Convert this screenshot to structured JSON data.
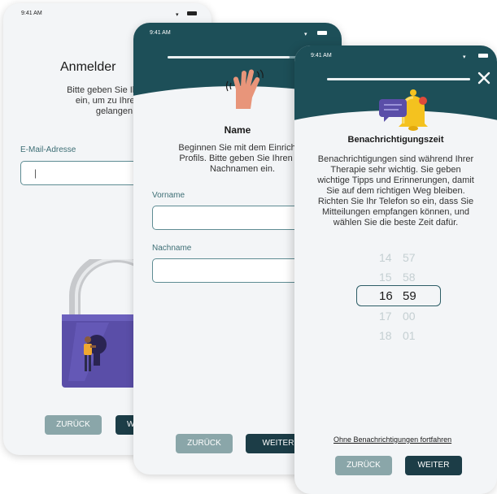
{
  "colors": {
    "header": "#1d4f58",
    "accent": "#1c3d47",
    "secondary_button": "#8aa6a9",
    "input_border": "#5e8c93"
  },
  "screen1": {
    "time": "9:41 AM",
    "title": "Anmelder",
    "description": "Bitte geben Sie Ihre E-M\nein, um zu Ihrer The\ngelangen.",
    "email_label": "E-Mail-Adresse",
    "email_value": "|",
    "back_label": "ZURÜCK",
    "next_label": "WE",
    "illustration": "padlock-with-person-icon"
  },
  "screen2": {
    "time": "9:41 AM",
    "progress": 0.7,
    "icon": "waving-hand-icon",
    "title": "Name",
    "description": "Beginnen Sie mit dem Einrichter\nProfils. Bitte geben Sie Ihren Vo\nNachnamen ein.",
    "first_name_label": "Vorname",
    "last_name_label": "Nachname",
    "back_label": "ZURÜCK",
    "next_label": "WEITER"
  },
  "screen3": {
    "time": "9:41 AM",
    "progress": 1.0,
    "icon": "bell-with-message-icon",
    "close_icon": "close-icon",
    "title": "Benachrichtigungszeit",
    "description": "Benachrichtigungen sind während Ihrer\nTherapie sehr wichtig. Sie geben\nwichtige Tipps und Erinnerungen, damit\nSie auf dem richtigen Weg bleiben.\nRichten Sie Ihr Telefon so ein, dass Sie\nMitteilungen empfangen können, und\nwählen Sie die beste Zeit dafür.",
    "picker": {
      "hours": [
        "14",
        "15",
        "16",
        "17",
        "18"
      ],
      "minutes": [
        "57",
        "58",
        "59",
        "00",
        "01"
      ],
      "selected_hour": "16",
      "selected_minute": "59"
    },
    "skip_link": "Ohne Benachrichtigungen fortfahren",
    "back_label": "ZURÜCK",
    "next_label": "WEITER"
  }
}
